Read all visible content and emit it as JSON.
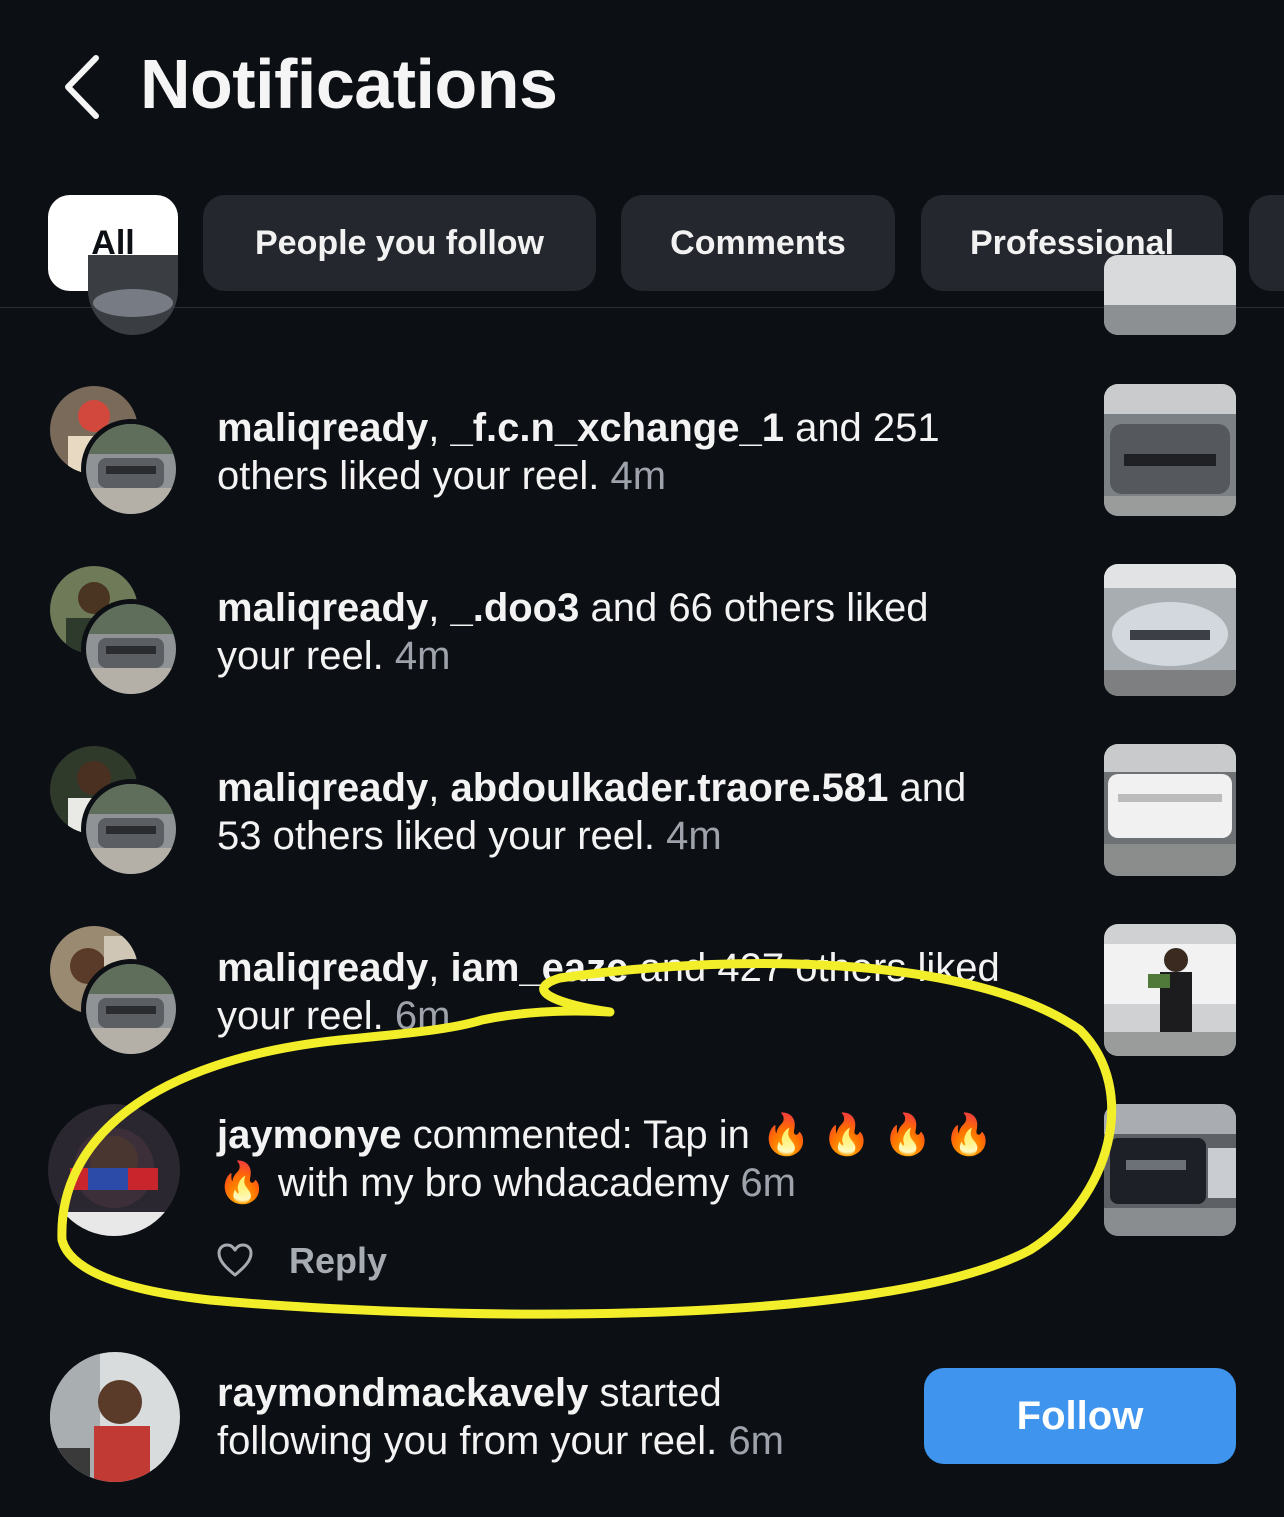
{
  "header": {
    "title": "Notifications"
  },
  "filters": [
    {
      "label": "All",
      "active": true
    },
    {
      "label": "People you follow"
    },
    {
      "label": "Comments"
    },
    {
      "label": "Professional"
    }
  ],
  "notifications": [
    {
      "user1": "maliqready",
      "sep": ", ",
      "user2": "_f.c.n_xchange_1",
      "line1_rest": " and 251",
      "line2": "others liked your reel.",
      "time": "4m"
    },
    {
      "user1": "maliqready",
      "sep": ", ",
      "user2": "_.doo3",
      "line1_rest": " and 66 others liked",
      "line2": "your reel.",
      "time": "4m"
    },
    {
      "user1": "maliqready",
      "sep": ", ",
      "user2": "abdoulkader.traore.581",
      "line1_rest": " and",
      "line2": "53 others liked your reel.",
      "time": "4m"
    },
    {
      "user1": "maliqready",
      "sep": ", ",
      "user2": "iam_eaze",
      "line1_rest": " and 427 others liked",
      "line2": "your reel.",
      "time": "6m"
    },
    {
      "user1": "jaymonye",
      "line1_rest": " commented: Tap in ",
      "line2": " with my bro whdacademy",
      "time": "6m",
      "reply_label": "Reply",
      "emoji": "🔥"
    },
    {
      "user1": "raymondmackavely",
      "line1_rest": " started",
      "line2": "following you from your reel.",
      "time": "6m",
      "button_label": "Follow"
    }
  ],
  "colors": {
    "background": "#0c0f14",
    "chip": "#24272d",
    "follow": "#3f95ee",
    "highlight": "#f3ee2a",
    "muted": "#9ea3ab"
  }
}
